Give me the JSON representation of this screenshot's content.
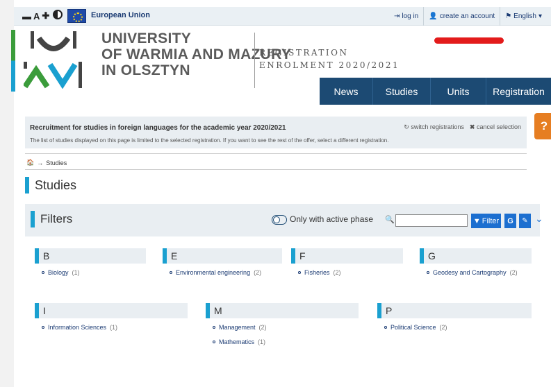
{
  "topbar": {
    "a11y": {
      "decrease": "▬",
      "letter": "A",
      "increase": "✚"
    },
    "eu_label": "European Union",
    "login": "log in",
    "create_account": "create an account",
    "language": "English"
  },
  "header": {
    "university_lines": [
      "UNIVERSITY",
      "OF WARMIA AND MAZURY",
      "IN OLSZTYN"
    ],
    "registration_lines": [
      "REGISTRATION",
      "ENROLMENT 2020/2021"
    ]
  },
  "nav": {
    "items": [
      "News",
      "Studies",
      "Units",
      "Registration"
    ]
  },
  "help_label": "?",
  "info": {
    "title": "Recruitment for studies in foreign languages for the academic year 2020/2021",
    "description": "The list of studies displayed on this page is limited to the selected registration. If you want to see the rest of the offer, select a different registration.",
    "switch_label": "switch registrations",
    "cancel_label": "cancel selection"
  },
  "breadcrumb": {
    "current": "Studies"
  },
  "page_title": "Studies",
  "filters": {
    "title": "Filters",
    "active_phase_label": "Only with active phase",
    "search_placeholder": "",
    "filter_button": "Filter",
    "g_button": "G"
  },
  "groups": [
    {
      "letter": "B",
      "items": [
        {
          "name": "Biology",
          "count": "(1)"
        }
      ]
    },
    {
      "letter": "E",
      "items": [
        {
          "name": "Environmental engineering",
          "count": "(2)"
        }
      ]
    },
    {
      "letter": "F",
      "items": [
        {
          "name": "Fisheries",
          "count": "(2)"
        }
      ]
    },
    {
      "letter": "G",
      "items": [
        {
          "name": "Geodesy and Cartography",
          "count": "(2)"
        }
      ]
    },
    {
      "letter": "I",
      "items": [
        {
          "name": "Information Sciences",
          "count": "(1)"
        }
      ]
    },
    {
      "letter": "M",
      "items": [
        {
          "name": "Management",
          "count": "(2)"
        },
        {
          "name": "Mathematics",
          "count": "(1)"
        }
      ]
    },
    {
      "letter": "P",
      "items": [
        {
          "name": "Political Science",
          "count": "(2)"
        }
      ]
    }
  ],
  "colors": {
    "navy": "#1c4a73",
    "accent_blue": "#1aa0d0",
    "green": "#3b9c3b",
    "button_blue": "#1c6fd0",
    "help_orange": "#e67e22"
  }
}
